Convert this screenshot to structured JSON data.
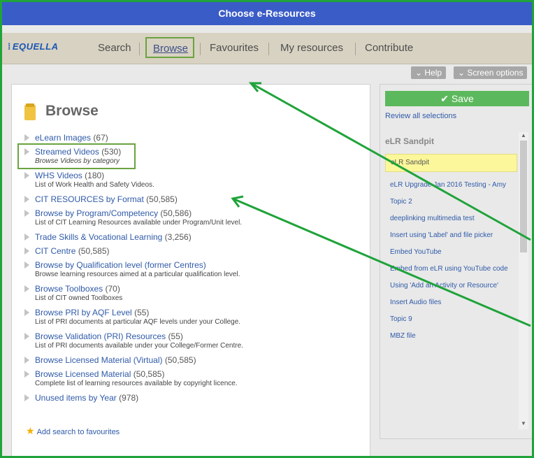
{
  "window": {
    "title": "Choose e-Resources"
  },
  "logo": {
    "text": "EQUELLA"
  },
  "nav": {
    "search": "Search",
    "browse": "Browse",
    "favourites": "Favourites",
    "my_resources": "My resources",
    "contribute": "Contribute"
  },
  "toolbar": {
    "help": "Help",
    "screen_options": "Screen options"
  },
  "browse": {
    "heading": "Browse",
    "items": [
      {
        "title": "eLearn Images",
        "count": "(67)",
        "desc": ""
      },
      {
        "title": "Streamed Videos",
        "count": "(530)",
        "desc": "Browse Videos by category"
      },
      {
        "title": "WHS Videos",
        "count": "(180)",
        "desc": "List of Work Health and Safety Videos."
      },
      {
        "title": "CIT RESOURCES by Format",
        "count": "(50,585)",
        "desc": ""
      },
      {
        "title": "Browse by Program/Competency",
        "count": "(50,586)",
        "desc": "List of CIT Learning Resources available under Program/Unit level."
      },
      {
        "title": "Trade Skills & Vocational Learning",
        "count": "(3,256)",
        "desc": ""
      },
      {
        "title": "CIT Centre",
        "count": "(50,585)",
        "desc": ""
      },
      {
        "title": "Browse by Qualification level (former Centres)",
        "count": "",
        "desc": "Browse learning resources aimed at a particular qualification level."
      },
      {
        "title": "Browse Toolboxes",
        "count": "(70)",
        "desc": "List of CIT owned Toolboxes"
      },
      {
        "title": "Browse PRI by AQF Level",
        "count": "(55)",
        "desc": "List of PRI documents at particular AQF levels under your College."
      },
      {
        "title": "Browse Validation (PRI) Resources",
        "count": "(55)",
        "desc": "List of PRI documents available under your College/Former Centre."
      },
      {
        "title": "Browse Licensed Material (Virtual)",
        "count": "(50,585)",
        "desc": ""
      },
      {
        "title": "Browse Licensed Material",
        "count": "(50,585)",
        "desc": "Complete list of learning resources available by copyright licence."
      },
      {
        "title": "Unused items by Year",
        "count": "(978)",
        "desc": ""
      }
    ],
    "add_favourite": "Add search to favourites"
  },
  "selection": {
    "save": "Save",
    "review": "Review all selections",
    "title": "eLR Sandpit",
    "items": [
      "eLR Sandpit",
      "eLR Upgrade Jan 2016 Testing - Amy",
      "Topic 2",
      "deeplinking multimedia test",
      "Insert using 'Label' and file picker",
      "Embed YouTube",
      "Embed from eLR using YouTube code",
      "Using 'Add an Activity or Resource'",
      "Insert Audio files",
      "Topic 9",
      "MBZ file"
    ]
  },
  "colors": {
    "accent_green": "#1fa33a",
    "title_blue": "#3a5cc7",
    "link_blue": "#2f5aa8",
    "save_green": "#5cb85c"
  }
}
